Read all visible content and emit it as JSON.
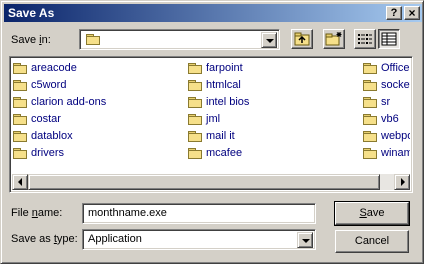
{
  "window": {
    "title": "Save As",
    "help_glyph": "?",
    "close_glyph": "×"
  },
  "save_in": {
    "label_prefix": "Save ",
    "label_accel": "i",
    "label_suffix": "n:",
    "current_folder": ""
  },
  "toolbar": {
    "up_one_level": "up-folder-icon",
    "create_new_folder": "new-folder-icon",
    "list_view": "list-view-icon",
    "details_view": "details-view-icon"
  },
  "files": {
    "columns": [
      [
        "areacode",
        "c5word",
        "clarion add-ons",
        "costar",
        "datablox",
        "drivers"
      ],
      [
        "farpoint",
        "htmlcal",
        "intel bios",
        "jml",
        "mail it",
        "mcafee"
      ],
      [
        "Office a",
        "socket",
        "sr",
        "vb6",
        "webpos",
        "winamp"
      ]
    ]
  },
  "file_name": {
    "label_prefix": "File ",
    "label_accel": "n",
    "label_suffix": "ame:",
    "value": "monthname.exe"
  },
  "save_as_type": {
    "label_prefix": "Save as ",
    "label_accel": "t",
    "label_suffix": "ype:",
    "value": "Application"
  },
  "buttons": {
    "save_accel": "S",
    "save_rest": "ave",
    "cancel": "Cancel"
  },
  "colors": {
    "titlebar_start": "#0a246a",
    "titlebar_end": "#a6caf0",
    "face": "#d4d0c8",
    "item_text": "#00007f"
  }
}
